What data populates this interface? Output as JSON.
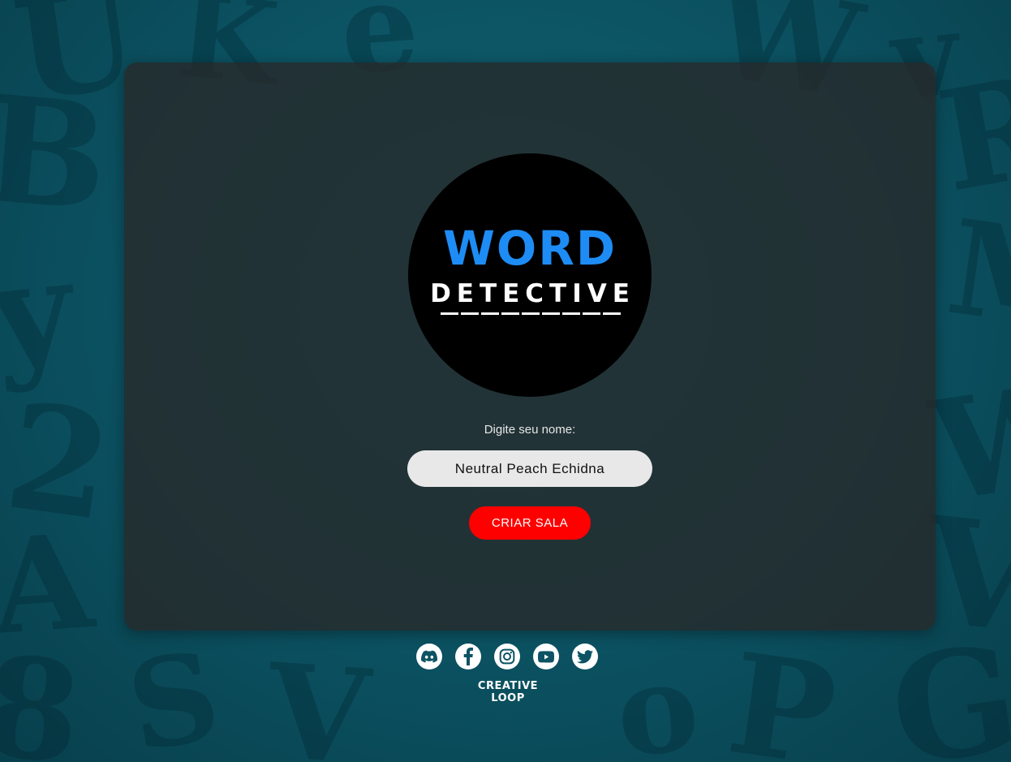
{
  "logo": {
    "word": "WORD",
    "detective": "DETECTIVE",
    "dash_count": 9
  },
  "form": {
    "name_label": "Digite seu nome:",
    "name_value": "Neutral Peach Echidna",
    "create_button": "CRIAR SALA"
  },
  "social": {
    "icons": [
      "discord-icon",
      "facebook-icon",
      "instagram-icon",
      "youtube-icon",
      "twitter-icon"
    ]
  },
  "footer": {
    "brand": "CREATIVE LOOP"
  },
  "colors": {
    "background": "#0d5363",
    "panel": "#282828",
    "logo_blue": "#1e8cf5",
    "button_red": "#ff0000",
    "input_bg": "#e8e8e8"
  }
}
